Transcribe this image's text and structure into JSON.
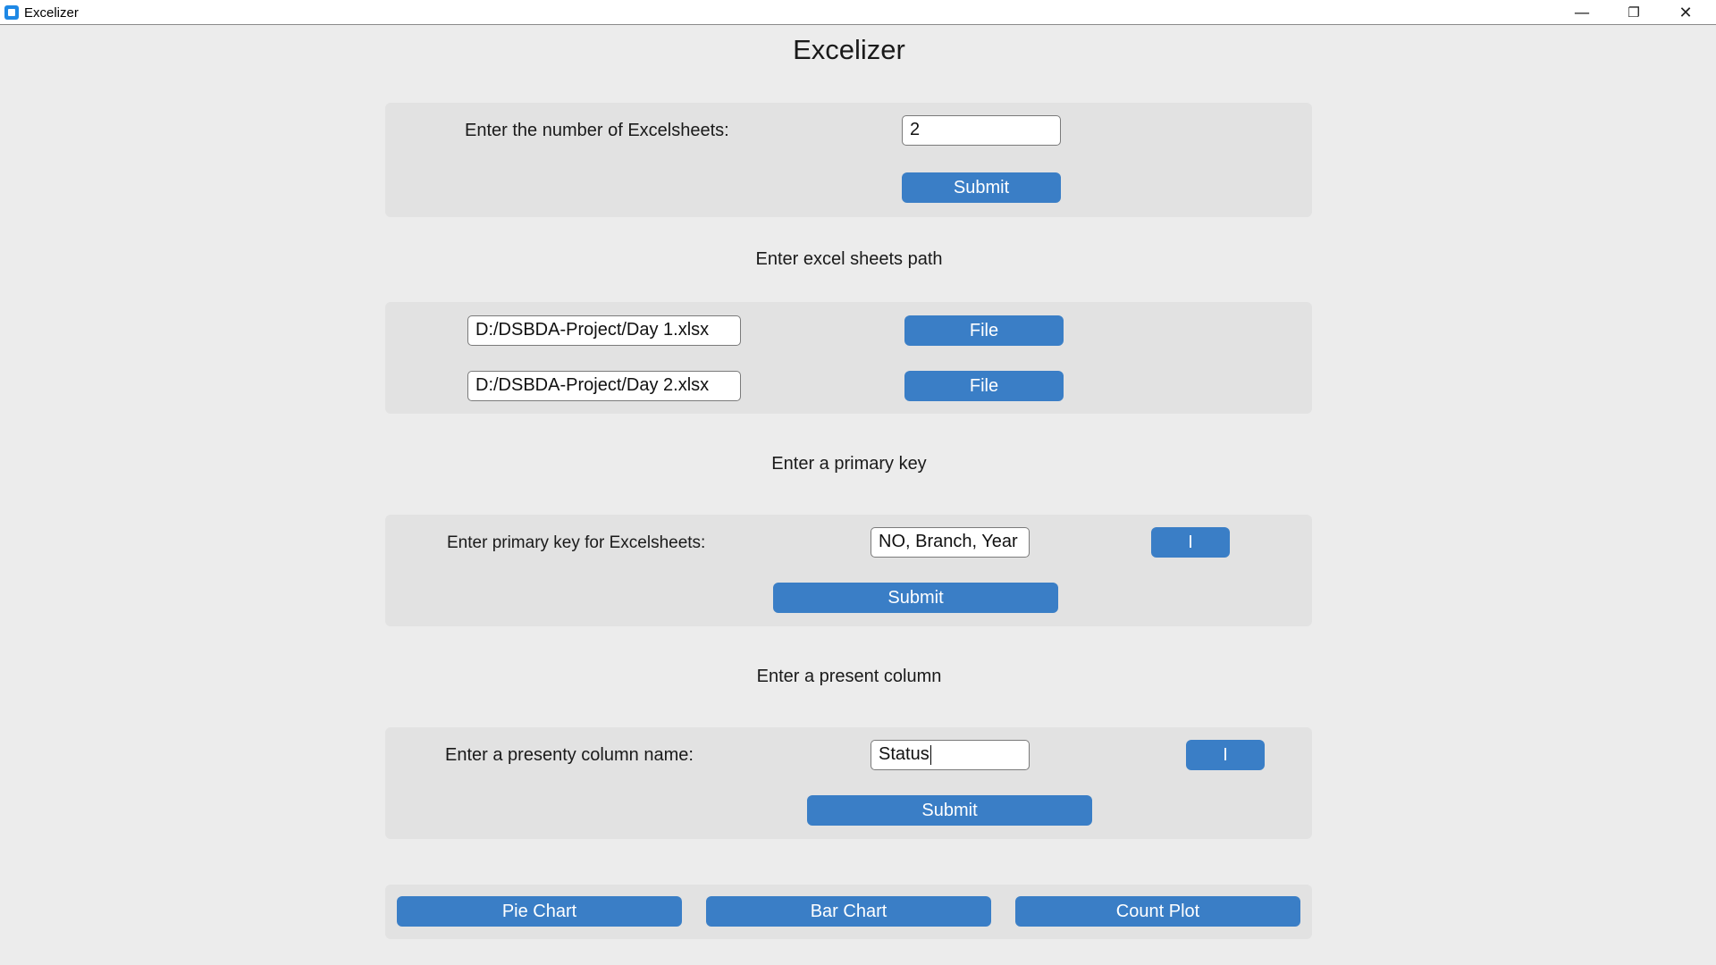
{
  "window": {
    "title": "Excelizer",
    "controls": {
      "minimize": "—",
      "maximize": "❐",
      "close": "✕"
    }
  },
  "app_title": "Excelizer",
  "sheet_count": {
    "label": "Enter the number of Excelsheets:",
    "value": "2",
    "submit_label": "Submit"
  },
  "paths": {
    "heading": "Enter excel sheets path",
    "files": [
      {
        "value": "D:/DSBDA-Project/Day 1.xlsx",
        "button_label": "File"
      },
      {
        "value": "D:/DSBDA-Project/Day 2.xlsx",
        "button_label": "File"
      }
    ]
  },
  "primary_key": {
    "heading": "Enter a primary key",
    "label": "Enter primary key for Excelsheets:",
    "value": "NO, Branch, Year",
    "info_label": "I",
    "submit_label": "Submit"
  },
  "present_column": {
    "heading": "Enter a present column",
    "label": "Enter a presenty column name:",
    "value": "Status",
    "info_label": "I",
    "submit_label": "Submit"
  },
  "charts": {
    "pie_label": "Pie Chart",
    "bar_label": "Bar Chart",
    "count_label": "Count Plot"
  },
  "colors": {
    "accent": "#3a7ec6",
    "panel": "#e2e2e2",
    "background": "#ececec"
  }
}
